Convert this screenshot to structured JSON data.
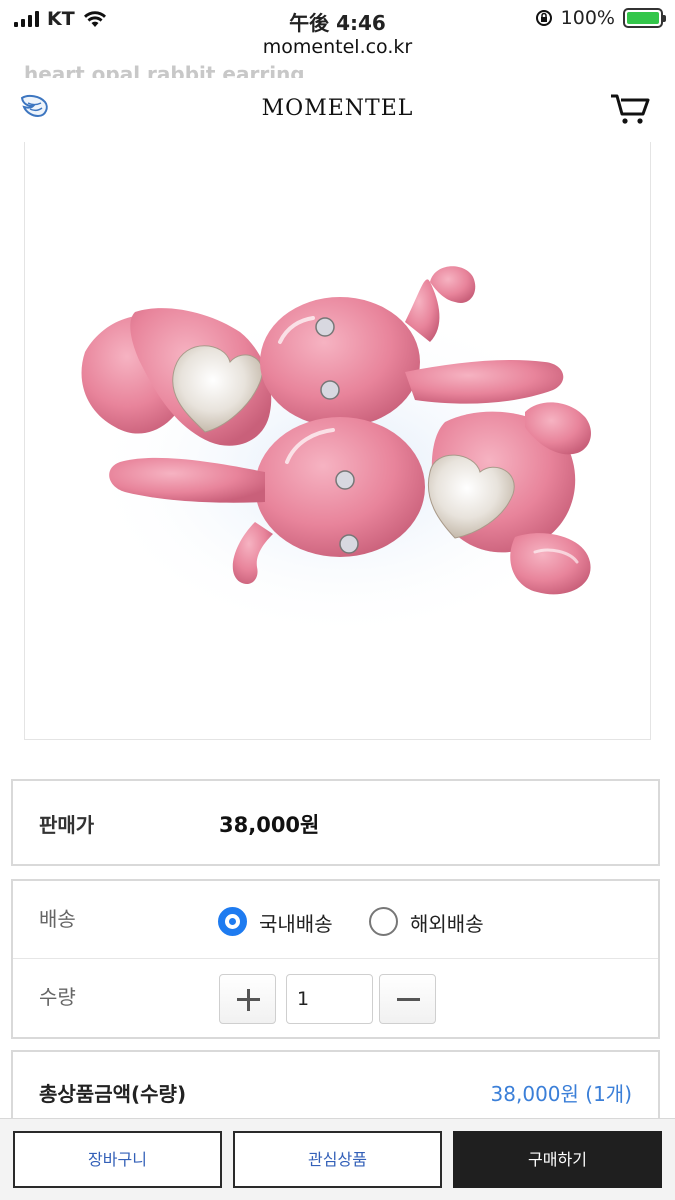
{
  "status_bar": {
    "carrier": "KT",
    "time": "午後 4:46",
    "battery_percent": "100%",
    "battery_level": 1.0,
    "url": "momentel.co.kr"
  },
  "header": {
    "ghost_title": "heart opal rabbit earring",
    "brand": "MOMENTEL"
  },
  "product": {
    "image_alt": "pink rabbit earrings with heart opal stones"
  },
  "price": {
    "label": "판매가",
    "value": "38,000원"
  },
  "shipping": {
    "label": "배송",
    "options": [
      {
        "label": "국내배송",
        "selected": true
      },
      {
        "label": "해외배송",
        "selected": false
      }
    ]
  },
  "quantity": {
    "label": "수량",
    "value": "1"
  },
  "total": {
    "label": "총상품금액(수량)",
    "value": "38,000원 (1개)"
  },
  "bottom_bar": {
    "cart_label": "장바구니",
    "wishlist_label": "관심상품",
    "buy_label": "구매하기"
  },
  "colors": {
    "accent_blue": "#1e7bf0",
    "total_blue": "#3b7fd8",
    "product_pink": "#e8849b",
    "buy_button": "#1f1f1f"
  }
}
